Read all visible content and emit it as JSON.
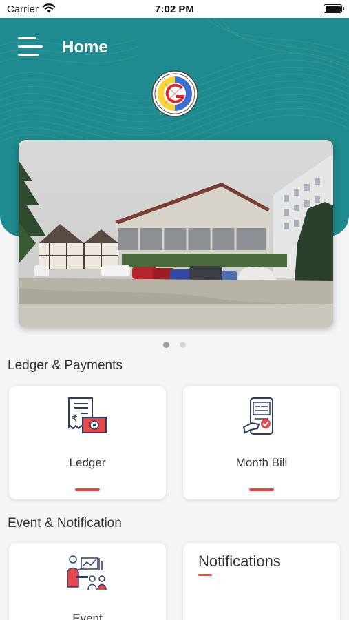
{
  "status_bar": {
    "carrier": "Carrier",
    "time": "7:02 PM"
  },
  "header": {
    "title": "Home",
    "menu_icon": "hamburger-menu-icon",
    "background_color": "#1f8a8f"
  },
  "carousel": {
    "page_count": 2,
    "active_index": 0
  },
  "sections": {
    "ledger": {
      "title": "Ledger & Payments",
      "cards": [
        {
          "label": "Ledger",
          "icon": "ledger-receipt-icon"
        },
        {
          "label": "Month Bill",
          "icon": "month-bill-icon"
        }
      ]
    },
    "events": {
      "title": "Event & Notification",
      "event_label": "Event",
      "event_icon": "event-people-icon",
      "notifications_title": "Notifications"
    }
  },
  "accent_color": "#e94646"
}
